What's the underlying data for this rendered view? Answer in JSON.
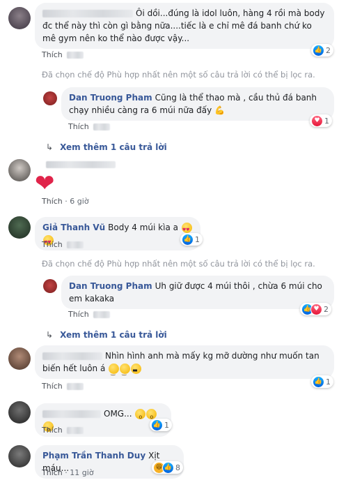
{
  "c1": {
    "text": "Ôi dồi...đúng là idol luôn, hàng 4 rồi mà body đc thể này thì còn gì bằng nữa....tiếc là e chỉ mê đá banh chứ ko mê gym nên ko thể nào được vậy...",
    "like": "Thích",
    "react_count": "2",
    "notice": "Đã chọn chế độ Phù hợp nhất nên một số câu trả lời có thể bị lọc ra.",
    "reply": {
      "author": "Dan Truong Pham",
      "text": "Cũng là thể thao mà , cầu thủ đá banh chạy nhiều càng ra 6 múi nữa đấy 💪",
      "like": "Thích",
      "react_count": "1"
    },
    "more": "Xem thêm 1 câu trả lời"
  },
  "c2": {
    "like": "Thích",
    "time": "6 giờ"
  },
  "c3": {
    "author": "Giả Thanh Vũ",
    "text": "Body 4 múi kìa a",
    "like": "Thích",
    "react_count": "1",
    "notice": "Đã chọn chế độ Phù hợp nhất nên một số câu trả lời có thể bị lọc ra.",
    "reply": {
      "author": "Dan Truong Pham",
      "text": "Uh giữ được 4 múi thôi , chừa 6 múi cho em kakaka",
      "like": "Thích",
      "react_count": "2"
    },
    "more": "Xem thêm 1 câu trả lời"
  },
  "c4": {
    "text": "Nhìn hình anh mà mấy kg mỡ dường như muốn tan biến hết luôn á",
    "like": "Thích",
    "react_count": "1"
  },
  "c5": {
    "text": "OMG...",
    "like": "Thích",
    "react_count": "1"
  },
  "c6": {
    "author": "Phạm Trần Thanh Duy",
    "text": "Xịt máu...",
    "like": "Thích",
    "time": "11 giờ",
    "react_count": "8"
  },
  "colors": {
    "link": "#385898",
    "bubble": "#f2f3f5",
    "meta": "#606770",
    "notice": "#90949c"
  }
}
